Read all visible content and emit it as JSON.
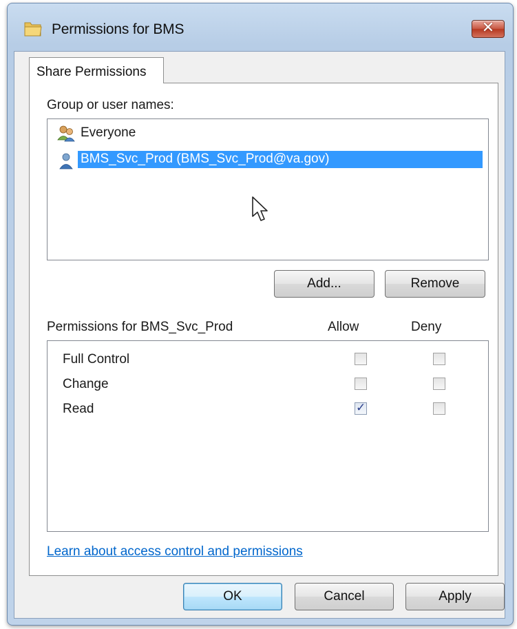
{
  "window": {
    "title": "Permissions for BMS",
    "close_symbol": "✕"
  },
  "tabs": [
    {
      "label": "Share Permissions",
      "active": true
    }
  ],
  "group_section": {
    "label": "Group or user names:",
    "items": [
      {
        "name": "Everyone",
        "icon": "group-users-icon",
        "selected": false
      },
      {
        "name": "BMS_Svc_Prod (BMS_Svc_Prod@va.gov)",
        "icon": "user-icon",
        "selected": true
      }
    ],
    "add_label": "Add...",
    "remove_label": "Remove"
  },
  "permissions_section": {
    "label": "Permissions for BMS_Svc_Prod",
    "allow_header": "Allow",
    "deny_header": "Deny",
    "rows": [
      {
        "name": "Full Control",
        "allow": false,
        "deny": false
      },
      {
        "name": "Change",
        "allow": false,
        "deny": false
      },
      {
        "name": "Read",
        "allow": true,
        "deny": false
      }
    ]
  },
  "link_text": "Learn about access control and permissions",
  "footer": {
    "ok_label": "OK",
    "cancel_label": "Cancel",
    "apply_label": "Apply"
  },
  "colors": {
    "selection": "#3399ff",
    "link": "#0066cc",
    "close_button": "#c95a45"
  }
}
